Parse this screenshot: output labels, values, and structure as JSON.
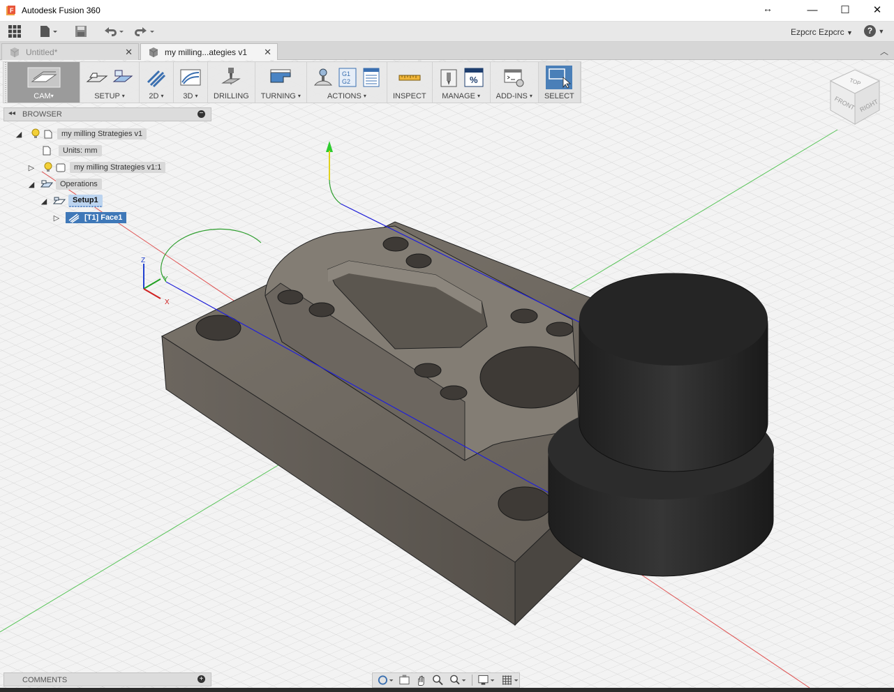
{
  "window": {
    "app_title": "Autodesk Fusion 360",
    "minimize": "—",
    "maximize": "☐",
    "close": "✕",
    "resize_glyph": "↔"
  },
  "qat": {
    "user_name": "Ezpcrc Ezpcrc",
    "user_caret": "▼",
    "help_glyph": "?",
    "help_caret": "▼"
  },
  "tabs": [
    {
      "label": "Untitled*",
      "close": "✕",
      "active": false
    },
    {
      "label": "my milling...ategies v1",
      "close": "✕",
      "active": true
    }
  ],
  "toolbar": {
    "cam": "CAM",
    "setup": "SETUP",
    "two_d": "2D",
    "three_d": "3D",
    "drilling": "DRILLING",
    "turning": "TURNING",
    "actions": "ACTIONS",
    "inspect": "INSPECT",
    "manage": "MANAGE",
    "addins": "ADD-INS",
    "select": "SELECT",
    "caret": "▾",
    "gcode_line1": "G1",
    "gcode_line2": "G2",
    "percent": "%"
  },
  "browser": {
    "title": "BROWSER",
    "collapse": "◂◂",
    "minus": "−",
    "items": [
      {
        "label": "my milling Strategies v1"
      },
      {
        "label": "Units: mm"
      },
      {
        "label": "my milling Strategies v1:1"
      },
      {
        "label": "Operations"
      },
      {
        "label": "Setup1"
      },
      {
        "label": "[T1] Face1"
      }
    ]
  },
  "triangles": {
    "expanded": "◢",
    "collapsed": "▷"
  },
  "viewcube": {
    "top": "TOP",
    "front": "FRONT",
    "right": "RIGHT"
  },
  "triad": {
    "x": "X",
    "y": "Y",
    "z": "Z"
  },
  "comments": {
    "title": "COMMENTS",
    "plus": "+"
  },
  "colors": {
    "accent": "#3f78b8",
    "part": "#6f6961",
    "tool": "#2a2a2a",
    "grid": "#d8d8d8"
  }
}
